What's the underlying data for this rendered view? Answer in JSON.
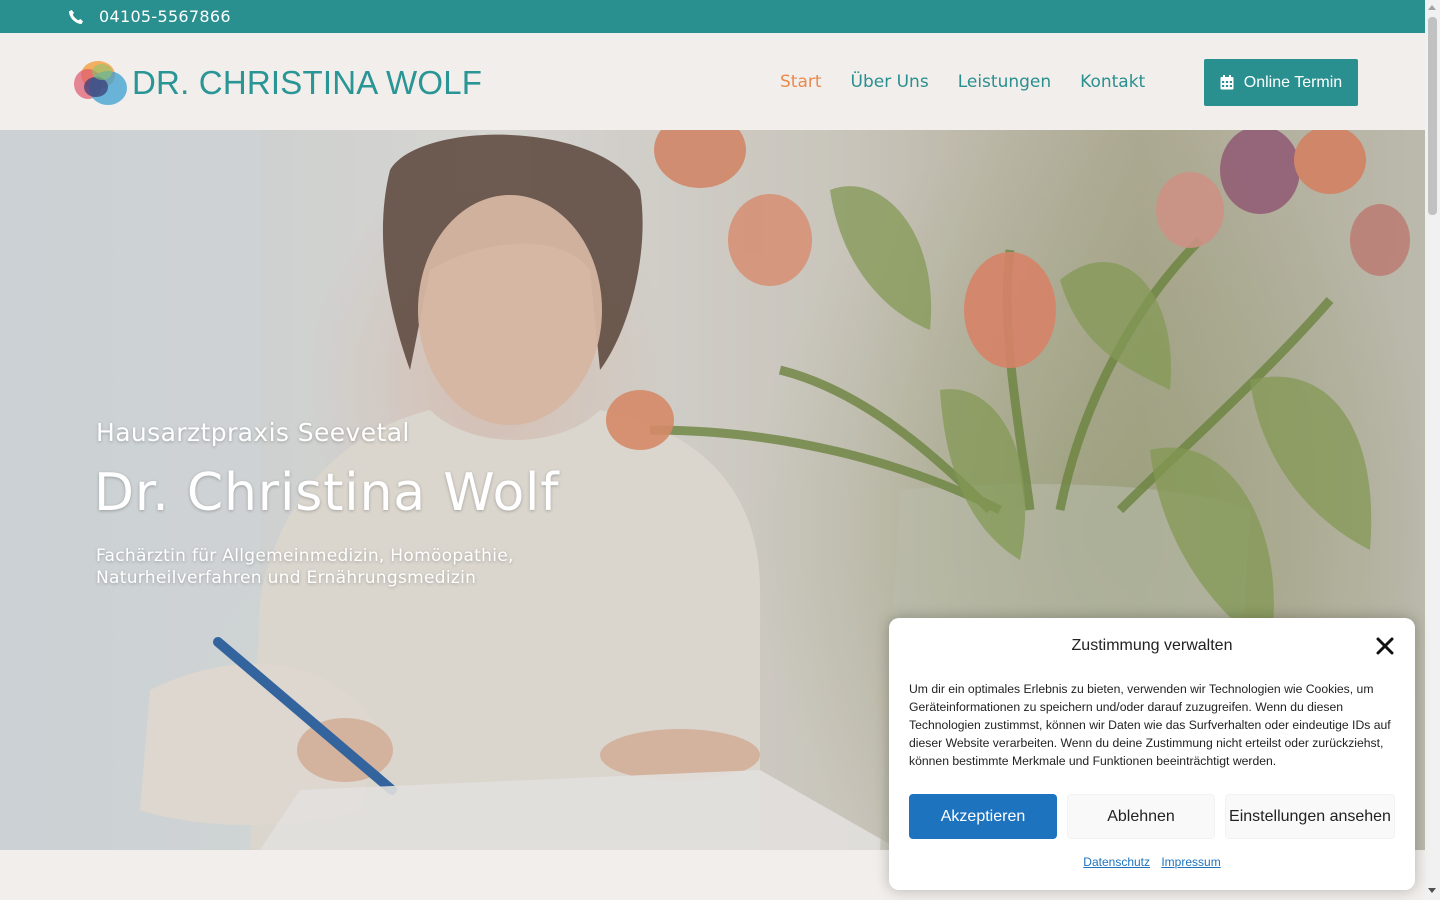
{
  "topbar": {
    "phone": "04105-5567866",
    "icon": "phone-icon"
  },
  "header": {
    "logo_text": "DR. CHRISTINA WOLF",
    "nav": [
      {
        "label": "Start",
        "active": true
      },
      {
        "label": "Über Uns",
        "active": false
      },
      {
        "label": "Leistungen",
        "active": false
      },
      {
        "label": "Kontakt",
        "active": false
      }
    ],
    "cta_label": "Online Termin",
    "cta_icon": "calendar-icon"
  },
  "hero": {
    "kicker": "Hausarztpraxis Seevetal",
    "title": "Dr. Christina Wolf",
    "subtitle_line1": "Fachärztin für Allgemeinmedizin, Homöopathie,",
    "subtitle_line2": "Naturheilverfahren und Ernährungsmedizin"
  },
  "cookie": {
    "title": "Zustimmung verwalten",
    "body": "Um dir ein optimales Erlebnis zu bieten, verwenden wir Technologien wie Cookies, um Ge­räte­informationen zu speichern und/oder darauf zuzugreifen. Wenn du diesen Technolo­gien zustimmst, können wir Daten wie das Surfverhalten oder eindeutige IDs auf dieser Website verarbeiten. Wenn du deine Zustimmung nicht erteilst oder zurückziehst, können bestimmte Merkmale und Funktionen beeinträchtigt werden.",
    "accept": "Akzeptieren",
    "deny": "Ablehnen",
    "preferences": "Einstellungen ansehen",
    "link_privacy": "Datenschutz",
    "link_imprint": "Impressum"
  },
  "colors": {
    "brand_teal": "#2a8f8f",
    "accent_orange": "#e98a4f",
    "cookie_blue": "#1e73be"
  }
}
